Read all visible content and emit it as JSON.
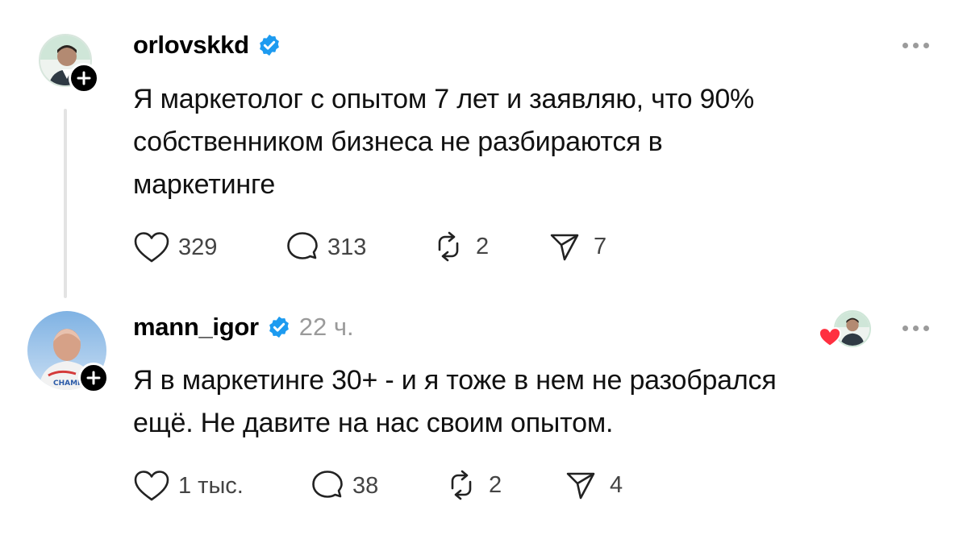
{
  "posts": [
    {
      "username": "orlovskkd",
      "verified": true,
      "time": "",
      "text": "Я маркетолог с опытом 7 лет и заявляю, что 90%\nсобственником бизнеса не разбираются в\nмаркетинге",
      "likes": "329",
      "comments": "313",
      "reposts": "2",
      "shares": "7"
    },
    {
      "username": "mann_igor",
      "verified": true,
      "time": "22 ч.",
      "text": "Я в маркетинге 30+ - и я тоже в нем не разобрался\nещё. Не давите на нас своим опытом.",
      "likes": "1 тыс.",
      "comments": "38",
      "reposts": "2",
      "shares": "4"
    }
  ],
  "colors": {
    "verified": "#1d9bf0",
    "heart_red": "#ff3040",
    "thread_line": "#e3e3e3",
    "muted": "#9a9a9a"
  },
  "icons": [
    "heart-icon",
    "comment-icon",
    "repost-icon",
    "share-icon",
    "verified-icon",
    "plus-icon",
    "more-icon"
  ]
}
